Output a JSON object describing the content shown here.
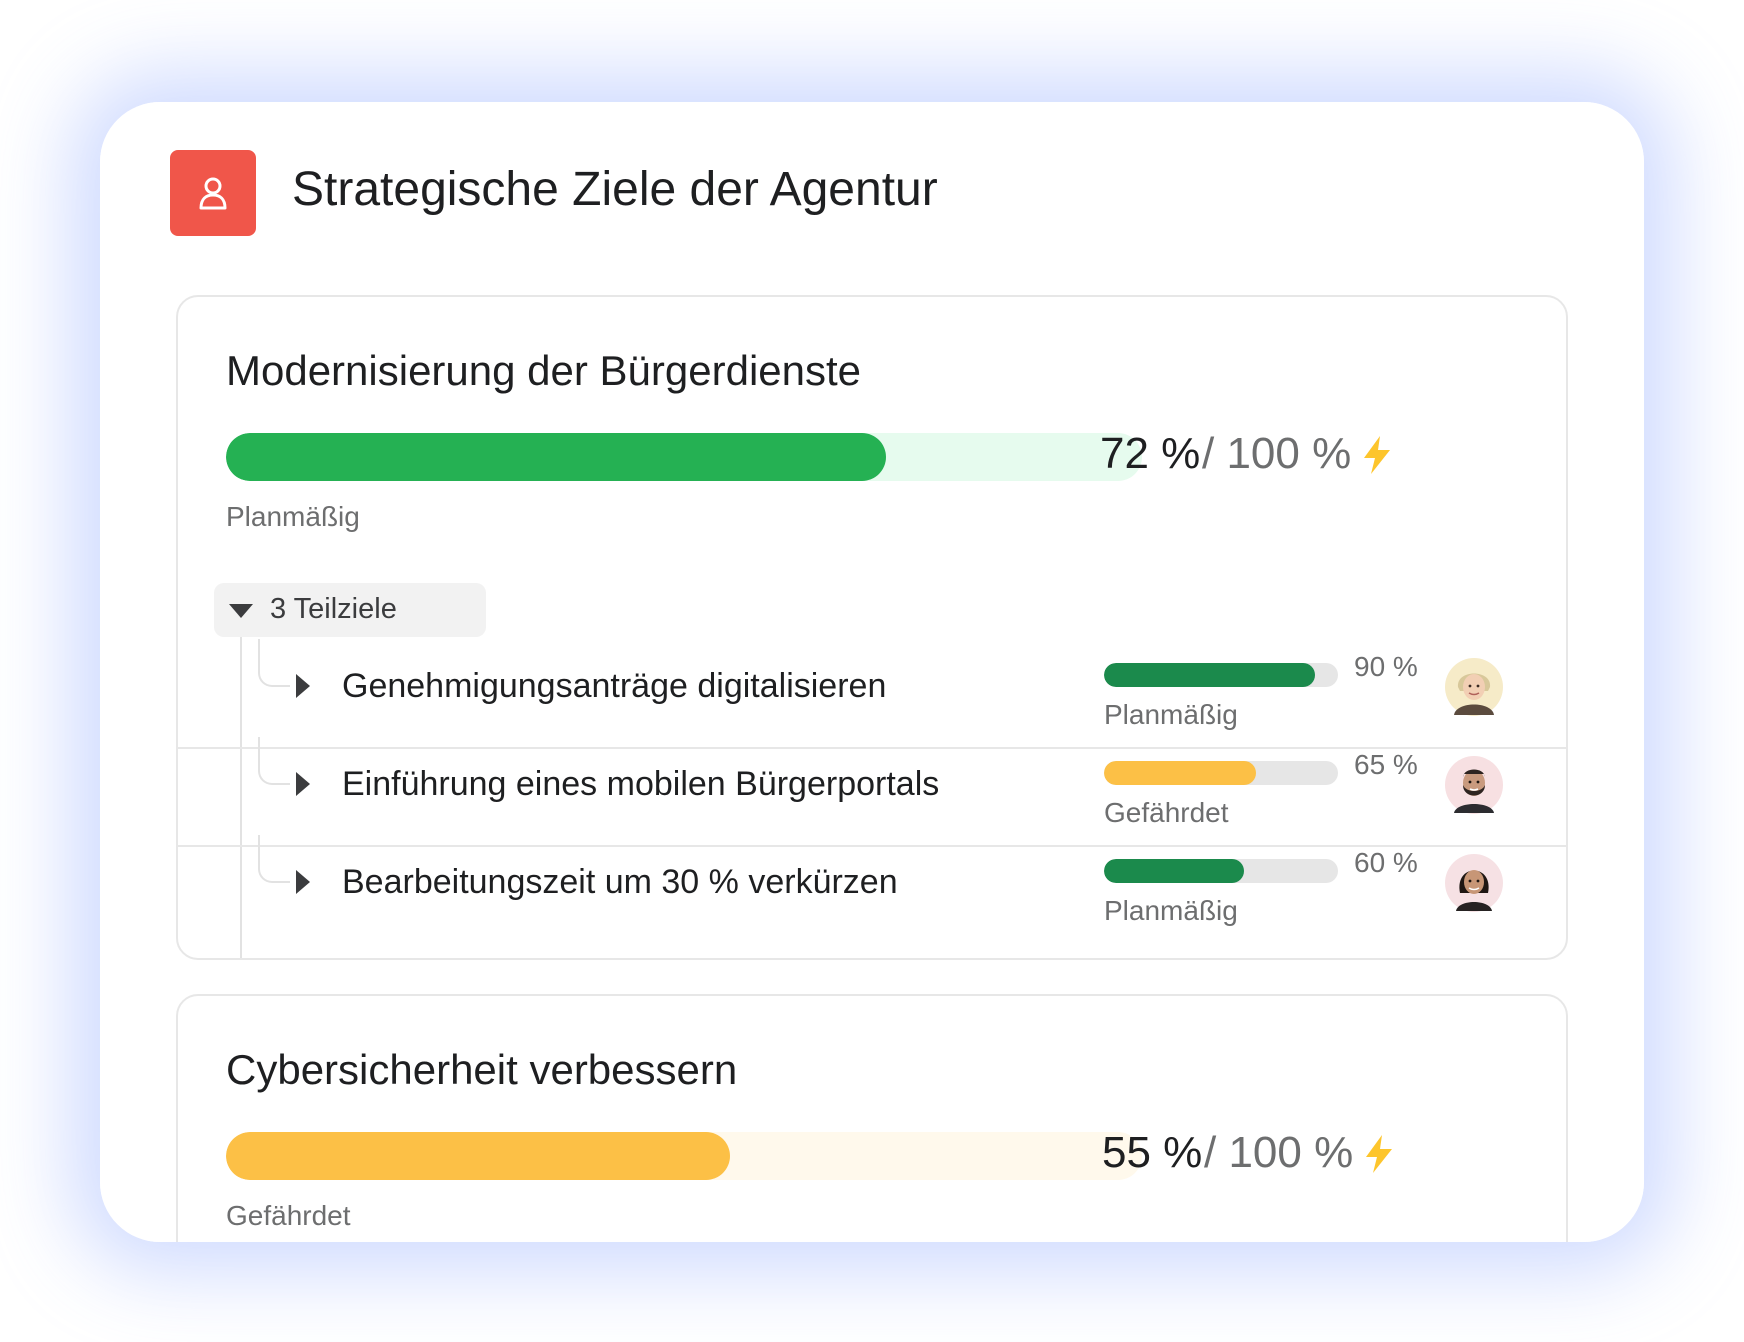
{
  "header": {
    "title": "Strategische Ziele der Agentur",
    "icon": "goal-person-icon",
    "icon_color": "#f0564a"
  },
  "goals": [
    {
      "title": "Modernisierung der Bürgerdienste",
      "progress_value": "72 %",
      "progress_target": "/ 100 %",
      "progress_fraction": 0.72,
      "status": "Planmäßig",
      "bar_color": "#25b153",
      "track_color": "#e6fbee",
      "icon": "lightning-icon",
      "subgoals_label": "3 Teilziele",
      "subgoals": [
        {
          "name": "Genehmigungsanträge digitalisieren",
          "percent": "90 %",
          "progress_fraction": 0.9,
          "status": "Planmäßig",
          "bar_color": "#1b8a4c",
          "avatar": "avatar-woman-blonde"
        },
        {
          "name": "Einführung eines mobilen Bürgerportals",
          "percent": "65 %",
          "progress_fraction": 0.65,
          "status": "Gefährdet",
          "bar_color": "#fcc046",
          "avatar": "avatar-man-beard"
        },
        {
          "name": "Bearbeitungszeit um 30 % verkürzen",
          "percent": "60 %",
          "progress_fraction": 0.6,
          "status": "Planmäßig",
          "bar_color": "#1b8a4c",
          "avatar": "avatar-woman-dark-hair"
        }
      ]
    },
    {
      "title": "Cybersicherheit verbessern",
      "progress_value": "55 %",
      "progress_target": "/ 100 %",
      "progress_fraction": 0.55,
      "status": "Gefährdet",
      "bar_color": "#fcc046",
      "track_color": "#fff9ec",
      "icon": "lightning-icon"
    }
  ]
}
